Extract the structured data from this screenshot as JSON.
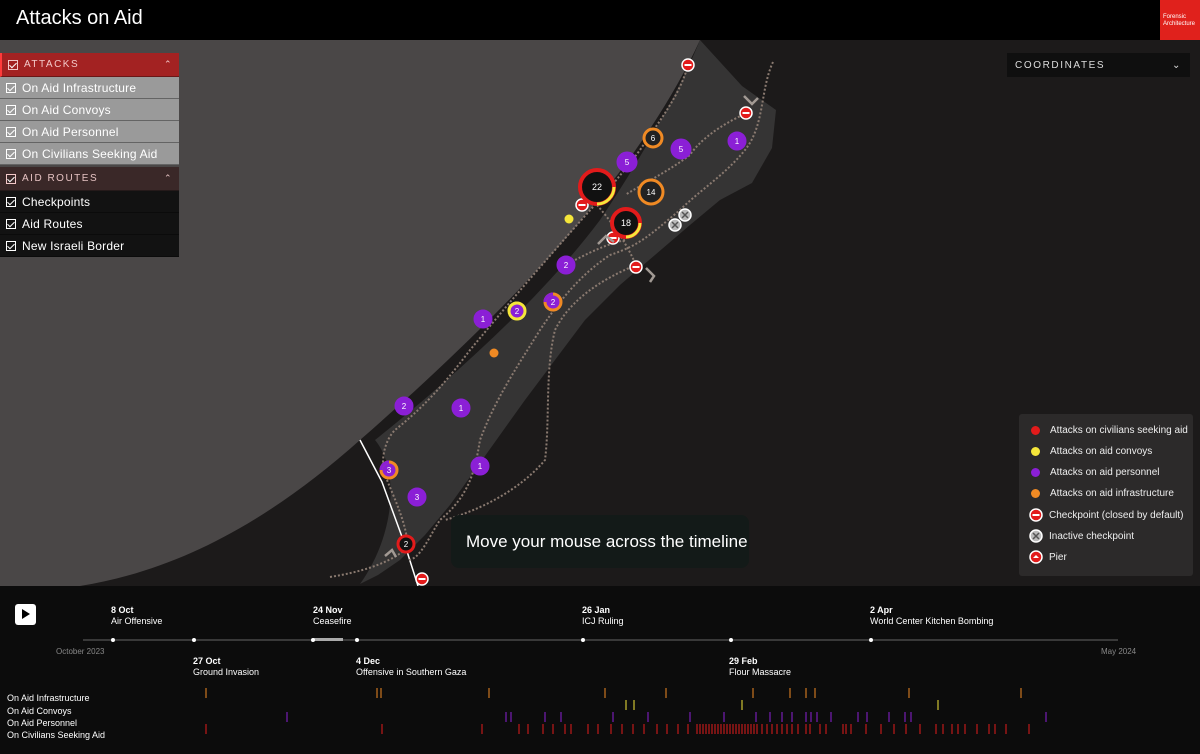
{
  "header": {
    "title": "Attacks on Aid",
    "logo_line1": "Forensic",
    "logo_line2": "Architecture"
  },
  "layers": {
    "attacks_label": "ATTACKS",
    "attack_items": [
      "On Aid Infrastructure",
      "On Aid Convoys",
      "On Aid Personnel",
      "On Civilians Seeking Aid"
    ],
    "routes_label": "AID ROUTES",
    "route_items": [
      "Checkpoints",
      "Aid Routes",
      "New Israeli Border"
    ]
  },
  "coordinates": {
    "label": "COORDINATES"
  },
  "legend": {
    "items": [
      {
        "label": "Attacks on civilians seeking aid",
        "color": "#e21b1b"
      },
      {
        "label": "Attacks on aid convoys",
        "color": "#f5e63a"
      },
      {
        "label": "Attacks on aid personnel",
        "color": "#8b1fd6"
      },
      {
        "label": "Attacks on aid infrastructure",
        "color": "#f08a24"
      }
    ],
    "checkpoint": "Checkpoint (closed by default)",
    "inactive": "Inactive checkpoint",
    "pier": "Pier"
  },
  "tooltip": {
    "text": "Move your mouse across the timeline"
  },
  "clusters": [
    {
      "n": "22",
      "kind": "civ"
    },
    {
      "n": "18",
      "kind": "civ"
    },
    {
      "n": "14",
      "kind": "infra"
    },
    {
      "n": "6",
      "kind": "infra"
    },
    {
      "n": "5",
      "kind": "pers"
    },
    {
      "n": "5",
      "kind": "pers"
    },
    {
      "n": "1",
      "kind": "pers"
    },
    {
      "n": "2",
      "kind": "pers"
    },
    {
      "n": "2",
      "kind": "mix"
    },
    {
      "n": "2",
      "kind": "conv"
    },
    {
      "n": "1",
      "kind": "pers"
    },
    {
      "n": "1",
      "kind": "pers"
    },
    {
      "n": "2",
      "kind": "pers"
    },
    {
      "n": "1",
      "kind": "pers"
    },
    {
      "n": "3",
      "kind": "mix"
    },
    {
      "n": "3",
      "kind": "pers"
    },
    {
      "n": "2",
      "kind": "civ"
    }
  ],
  "timeline": {
    "start_label": "October 2023",
    "end_label": "May 2024",
    "events": [
      {
        "date": "8 Oct",
        "name": "Air Offensive"
      },
      {
        "date": "24 Nov",
        "name": "Ceasefire"
      },
      {
        "date": "26 Jan",
        "name": "ICJ Ruling"
      },
      {
        "date": "2 Apr",
        "name": "World Center Kitchen Bombing"
      },
      {
        "date": "27 Oct",
        "name": "Ground Invasion"
      },
      {
        "date": "4 Dec",
        "name": "Offensive in Southern Gaza"
      },
      {
        "date": "29 Feb",
        "name": "Flour Massacre"
      }
    ],
    "rows": [
      "On Aid Infrastructure",
      "On Aid Convoys",
      "On Aid Personnel",
      "On Civilians Seeking Aid"
    ]
  }
}
